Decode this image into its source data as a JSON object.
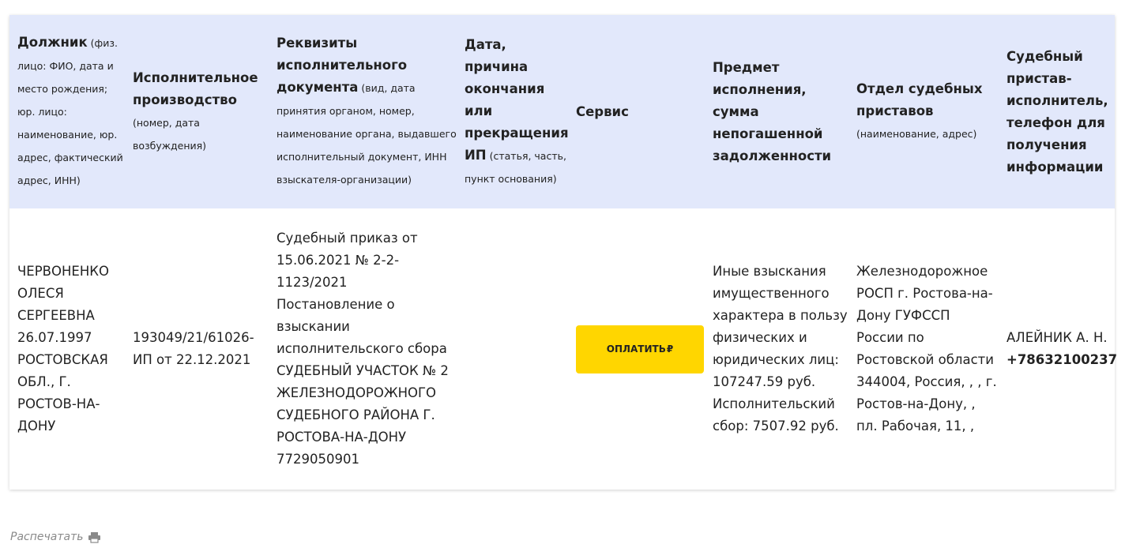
{
  "table": {
    "headers": [
      {
        "title": "Должник",
        "sub": " (физ. лицо: ФИО, дата и место рождения; юр. лицо: наименование, юр. адрес, фактический адрес, ИНН)"
      },
      {
        "title": "Исполнительное производство",
        "sub": "(номер, дата возбуждения)"
      },
      {
        "title": "Реквизиты исполнительного документа",
        "sub": " (вид, дата принятия органом, номер, наименование органа, выдавшего исполнительный документ, ИНН взыскателя-организации)"
      },
      {
        "title": "Дата, причина окончания или прекращения ИП",
        "sub": " (статья, часть, пункт основания)"
      },
      {
        "title": "Сервис",
        "sub": ""
      },
      {
        "title": "Предмет исполнения, сумма непогашенной задолженности",
        "sub": ""
      },
      {
        "title": "Отдел судебных приставов",
        "sub": "(наименование, адрес)"
      },
      {
        "title": "Судебный пристав-исполнитель, телефон для получения информации",
        "sub": ""
      }
    ],
    "row": {
      "debtor": "ЧЕРВОНЕНКО ОЛЕСЯ СЕРГЕЕВНА 26.07.1997 РОСТОВСКАЯ ОБЛ., Г. РОСТОВ-НА-ДОНУ",
      "proceeding": "193049/21/61026-ИП от 22.12.2021",
      "document_1": "Судебный приказ от 15.06.2021 № 2-2-1123/2021",
      "document_2": "Постановление о взыскании исполнительского сбора",
      "document_3": "СУДЕБНЫЙ УЧАСТОК № 2 ЖЕЛЕЗНОДОРОЖНОГО СУДЕБНОГО РАЙОНА Г. РОСТОВА-НА-ДОНУ",
      "document_4": "7729050901",
      "end_info": "",
      "pay_label": "ОПЛАТИТЬ",
      "pay_currency": "₽",
      "subject": "Иные взыскания имущественного характера в пользу физических и юридических лиц: 107247.59 руб.",
      "fee": "Исполнительский сбор: 7507.92 руб.",
      "department_name": "Железнодорожное РОСП г. Ростова-на-Дону ГУФССП России по Ростовской области",
      "department_address": "344004, Россия, , , г. Ростов-на-Дону, , пл. Рабочая, 11, ,",
      "bailiff": "АЛЕЙНИК А. Н.",
      "phone": "+78632100237"
    }
  },
  "print": {
    "label": "Распечатать",
    "icon": "printer-icon"
  },
  "colors": {
    "header_bg": "#e2e8fb",
    "button": "#ffd600",
    "muted": "#8a8a8a"
  }
}
